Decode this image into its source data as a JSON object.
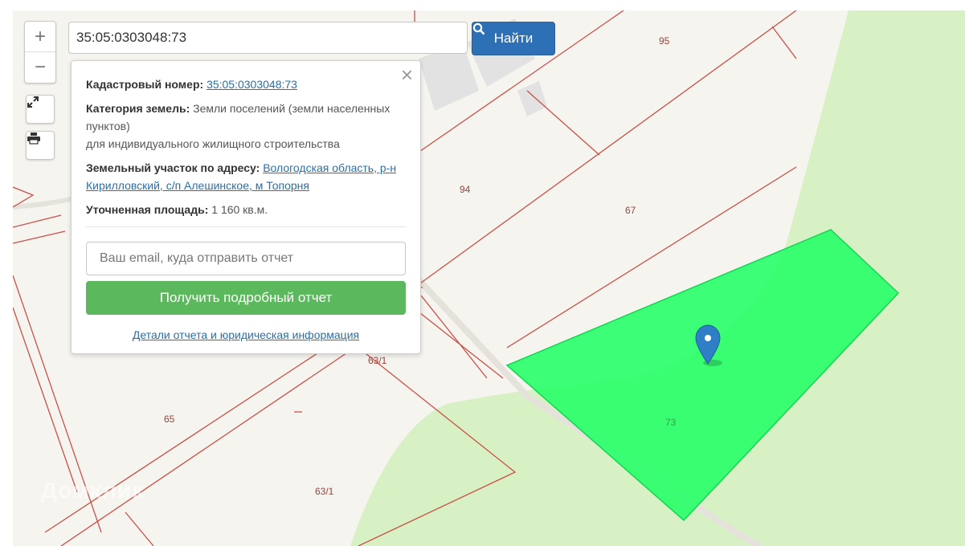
{
  "map": {
    "parcels": {
      "p95": "95",
      "p94": "94",
      "p67": "67",
      "p63_1_a": "63/1",
      "p65": "65",
      "p63_1_b": "63/1",
      "p73": "73"
    },
    "watermark": "Домклик",
    "colors": {
      "selected": "#22ff66",
      "forest": "#d8f1c4",
      "boundary": "#c9504a",
      "background": "#f6f4ef"
    },
    "marker_icon": "map-pin-icon"
  },
  "controls": {
    "zoom_in": "+",
    "zoom_out": "−",
    "fullscreen_icon": "expand-icon",
    "print_icon": "print-icon"
  },
  "search": {
    "value": "35:05:0303048:73",
    "button_label": "Найти",
    "button_icon": "search-icon"
  },
  "popup": {
    "cadastral_label": "Кадастровый номер:",
    "cadastral_value": "35:05:0303048:73",
    "category_label": "Категория земель:",
    "category_value": "Земли поселений (земли населенных пунктов)",
    "category_use": "для индивидуального жилищного строительства",
    "address_label": "Земельный участок по адресу:",
    "address_value": "Вологодская область, р-н Кирилловский, с/п Алешинское, м Топорня",
    "area_label": "Уточненная площадь:",
    "area_value": "1 160 кв.м.",
    "email_placeholder": "Ваш email, куда отправить отчет",
    "report_button": "Получить подробный отчет",
    "details_link": "Детали отчета и юридическая информация",
    "close_icon": "close-icon"
  }
}
